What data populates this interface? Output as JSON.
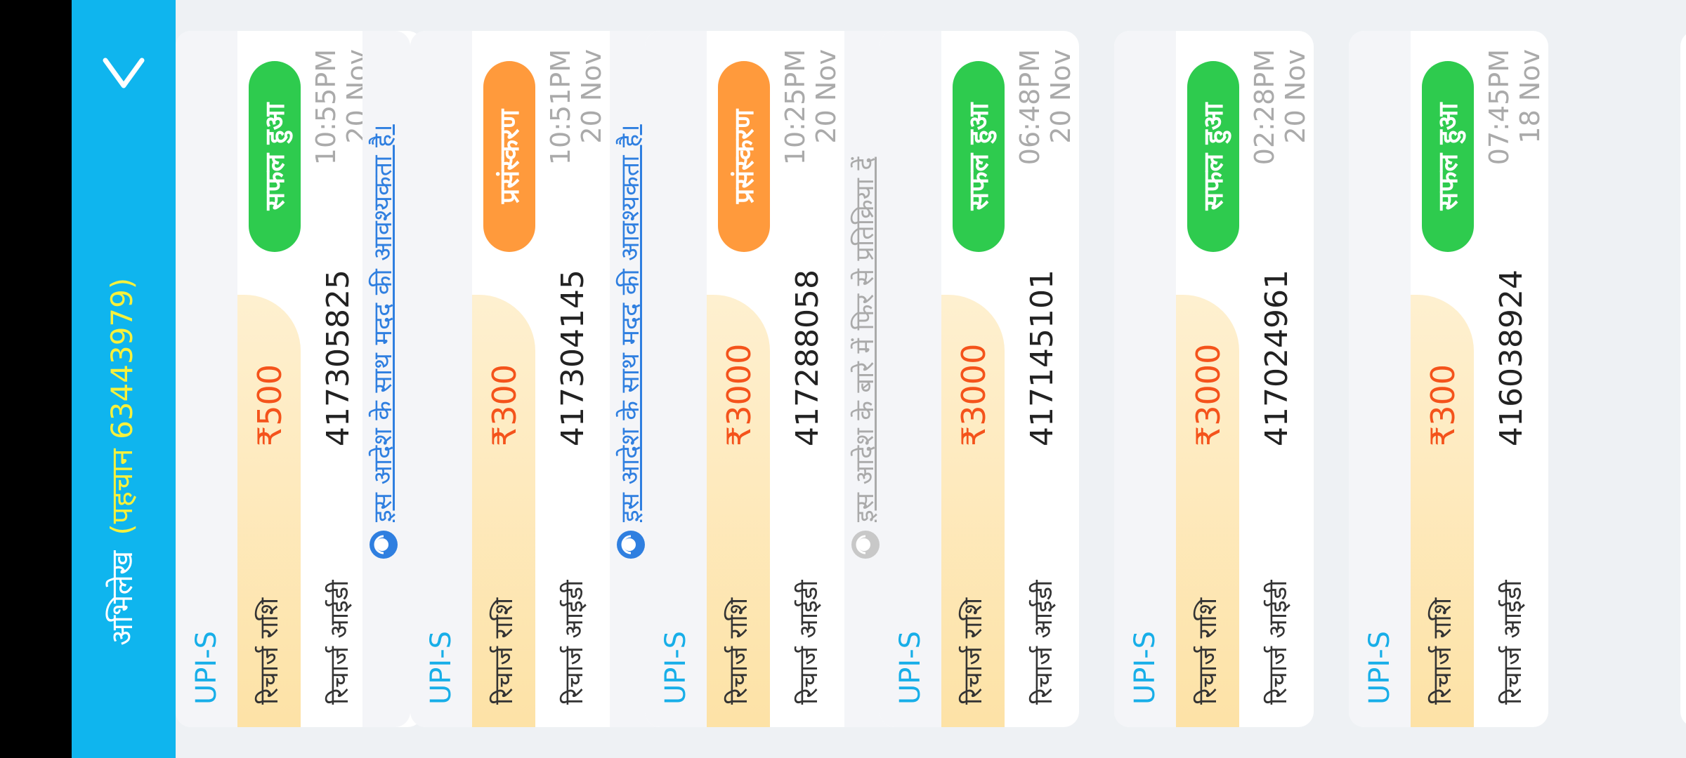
{
  "header": {
    "title": "अभिलेख",
    "subtitle": "(पहचान 63443979)"
  },
  "cards": [
    {
      "method": "UPI-S",
      "amount_label": "रिचार्ज राशि",
      "amount": "₹500",
      "id_label": "रिचार्ज आईडी",
      "id": "417305825",
      "status": "सफल हुआ",
      "status_color": "#2ecb4e",
      "time": "10:55PM",
      "date": "20 Nov",
      "help": "इस आदेश के साथ मदद की आवश्यकता है।"
    },
    {
      "method": "UPI-S",
      "amount_label": "रिचार्ज राशि",
      "amount": "₹300",
      "id_label": "रिचार्ज आईडी",
      "id": "417304145",
      "status": "प्रसंस्करण",
      "status_color": "#ff9a3c",
      "time": "10:51PM",
      "date": "20 Nov",
      "help": "इस आदेश के साथ मदद की आवश्यकता है।"
    },
    {
      "method": "UPI-S",
      "amount_label": "रिचार्ज राशि",
      "amount": "₹3000",
      "id_label": "रिचार्ज आईडी",
      "id": "417288058",
      "status": "प्रसंस्करण",
      "status_color": "#ff9a3c",
      "time": "10:25PM",
      "date": "20 Nov",
      "help": "इस आदेश के बारे में फिर से प्रतिक्रिया दें"
    },
    {
      "method": "UPI-S",
      "amount_label": "रिचार्ज राशि",
      "amount": "₹3000",
      "id_label": "रिचार्ज आईडी",
      "id": "417145101",
      "status": "सफल हुआ",
      "status_color": "#2ecb4e",
      "time": "06:48PM",
      "date": "20 Nov"
    },
    {
      "method": "UPI-S",
      "amount_label": "रिचार्ज राशि",
      "amount": "₹3000",
      "id_label": "रिचार्ज आईडी",
      "id": "417024961",
      "status": "सफल हुआ",
      "status_color": "#2ecb4e",
      "time": "02:28PM",
      "date": "20 Nov"
    },
    {
      "method": "UPI-S",
      "amount_label": "रिचार्ज राशि",
      "amount": "₹300",
      "id_label": "रिचार्ज आईडी",
      "id": "416038924",
      "status": "सफल हुआ",
      "status_color": "#2ecb4e",
      "time": "07:45PM",
      "date": "18 Nov"
    }
  ],
  "colors": {
    "header_bg": "#0fb5ee",
    "subtitle": "#f7f13c",
    "method": "#17aee8",
    "amount": "#f4531b",
    "link": "#2f7fe0"
  },
  "icons": {
    "back": "chevron-down-icon",
    "help": "support-agent-icon"
  }
}
